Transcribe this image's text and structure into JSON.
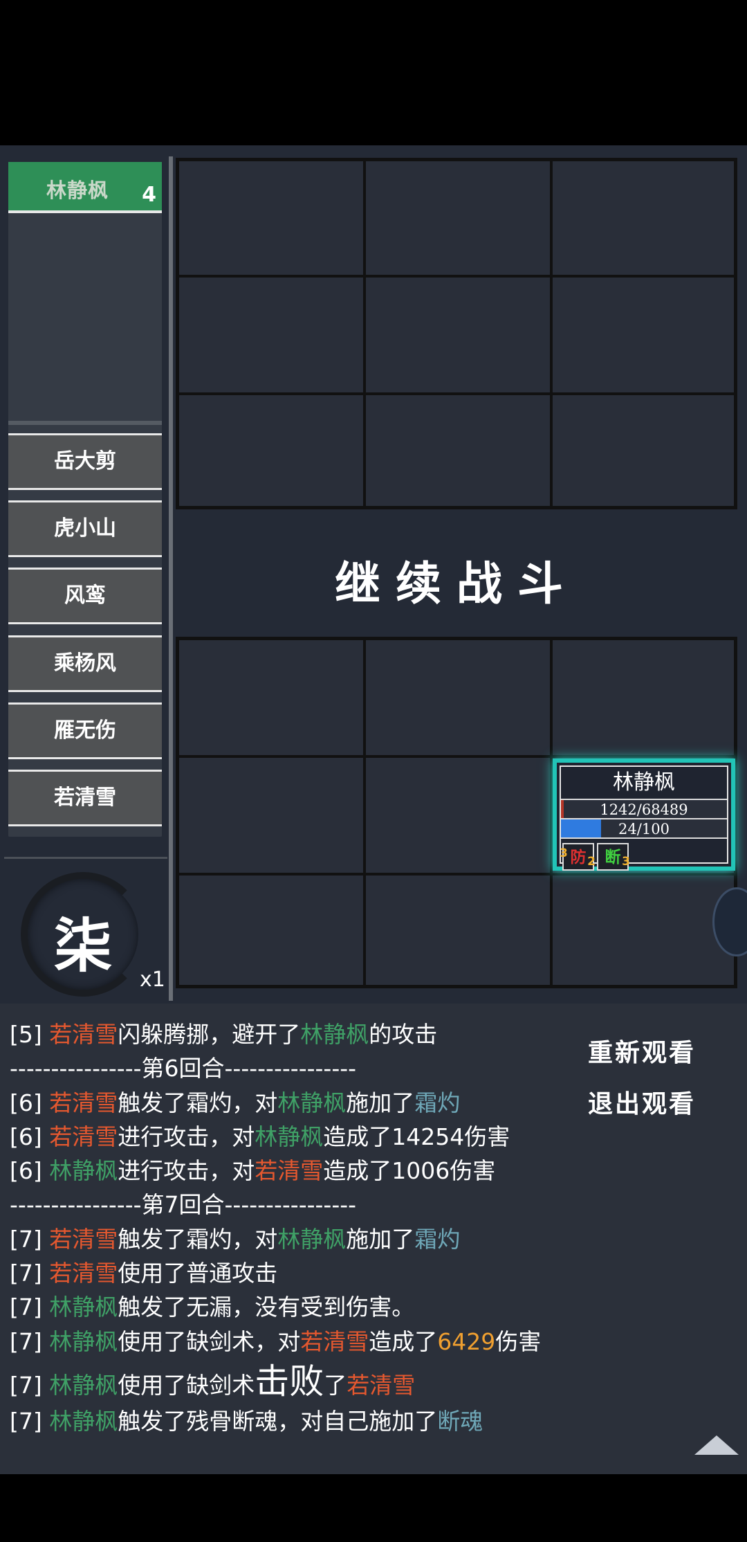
{
  "active_unit": {
    "name": "林静枫",
    "count": "4"
  },
  "roster": [
    "岳大剪",
    "虎小山",
    "风鸾",
    "乘杨风",
    "雁无伤",
    "若清雪"
  ],
  "speed": {
    "glyph": "柒",
    "multiplier": "x1"
  },
  "center_button": "继续战斗",
  "unit_card": {
    "name": "林静枫",
    "hp_text": "1242/68489",
    "hp_fraction": 0.018,
    "mp_text": "24/100",
    "mp_fraction": 0.24,
    "buffs": [
      {
        "top_left": "3",
        "label": "防",
        "bottom_right": "2",
        "color": "#e03030"
      },
      {
        "top_left": "",
        "label": "断",
        "bottom_right": "3",
        "color": "#40d040"
      }
    ]
  },
  "controls": {
    "replay": "重新观看",
    "exit": "退出观看"
  },
  "log": [
    [
      [
        "[5] ",
        ""
      ],
      [
        "若清雪",
        "r"
      ],
      [
        "闪躲腾挪，避开了",
        ""
      ],
      [
        "林静枫",
        "n"
      ],
      [
        "的攻击",
        ""
      ]
    ],
    [
      [
        "----------------第6回合----------------",
        ""
      ]
    ],
    [
      [
        "[6] ",
        ""
      ],
      [
        "若清雪",
        "r"
      ],
      [
        "触发了霜灼，对",
        ""
      ],
      [
        "林静枫",
        "n"
      ],
      [
        "施加了",
        ""
      ],
      [
        "霜灼",
        "b"
      ]
    ],
    [
      [
        "[6] ",
        ""
      ],
      [
        "若清雪",
        "r"
      ],
      [
        "进行攻击，对",
        ""
      ],
      [
        "林静枫",
        "n"
      ],
      [
        "造成了14254伤害",
        ""
      ]
    ],
    [
      [
        "[6] ",
        ""
      ],
      [
        "林静枫",
        "n"
      ],
      [
        "进行攻击，对",
        ""
      ],
      [
        "若清雪",
        "r"
      ],
      [
        "造成了1006伤害",
        ""
      ]
    ],
    [
      [
        "----------------第7回合----------------",
        ""
      ]
    ],
    [
      [
        "[7] ",
        ""
      ],
      [
        "若清雪",
        "r"
      ],
      [
        "触发了霜灼，对",
        ""
      ],
      [
        "林静枫",
        "n"
      ],
      [
        "施加了",
        ""
      ],
      [
        "霜灼",
        "b"
      ]
    ],
    [
      [
        "[7] ",
        ""
      ],
      [
        "若清雪",
        "r"
      ],
      [
        "使用了普通攻击",
        ""
      ]
    ],
    [
      [
        "[7] ",
        ""
      ],
      [
        "林静枫",
        "n"
      ],
      [
        "触发了无漏，没有受到伤害。",
        ""
      ]
    ],
    [
      [
        "[7] ",
        ""
      ],
      [
        "林静枫",
        "n"
      ],
      [
        "使用了缺剑术，对",
        ""
      ],
      [
        "若清雪",
        "r"
      ],
      [
        "造成了",
        ""
      ],
      [
        "6429",
        "o"
      ],
      [
        "伤害",
        ""
      ]
    ],
    [
      [
        "[7] ",
        ""
      ],
      [
        "林静枫",
        "n"
      ],
      [
        "使用了缺剑术",
        ""
      ],
      [
        "击败",
        "big"
      ],
      [
        "了",
        ""
      ],
      [
        "若清雪",
        "r"
      ]
    ],
    [
      [
        "[7] ",
        ""
      ],
      [
        "林静枫",
        "n"
      ],
      [
        "触发了残骨断魂，对自己施加了",
        ""
      ],
      [
        "断魂",
        "b"
      ]
    ]
  ]
}
